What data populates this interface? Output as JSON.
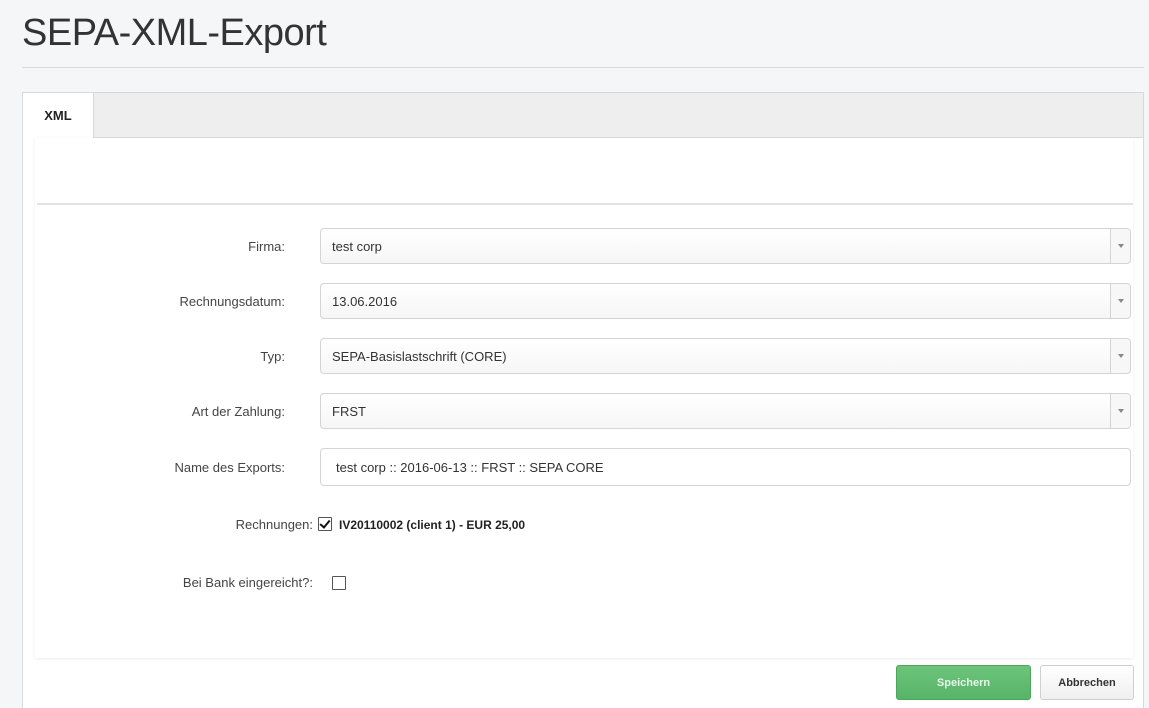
{
  "page": {
    "title": "SEPA-XML-Export"
  },
  "tabs": [
    {
      "label": "XML",
      "active": true
    }
  ],
  "form": {
    "firma": {
      "label": "Firma:",
      "value": "test corp"
    },
    "rechnungsdatum": {
      "label": "Rechnungsdatum:",
      "value": "13.06.2016"
    },
    "typ": {
      "label": "Typ:",
      "value": "SEPA-Basislastschrift (CORE)"
    },
    "art_der_zahlung": {
      "label": "Art der Zahlung:",
      "value": "FRST"
    },
    "name_des_exports": {
      "label": "Name des Exports:",
      "value": "test corp :: 2016-06-13 :: FRST :: SEPA CORE"
    },
    "rechnungen": {
      "label": "Rechnungen:",
      "items": [
        {
          "text": "IV20110002 (client 1) - EUR 25,00",
          "checked": true
        }
      ]
    },
    "bei_bank": {
      "label": "Bei Bank eingereicht?:",
      "checked": false
    }
  },
  "buttons": {
    "save_label": "Speichern",
    "cancel_label": "Abbrechen"
  },
  "colors": {
    "save_button": "#5cb96b",
    "background": "#f5f6f7"
  }
}
